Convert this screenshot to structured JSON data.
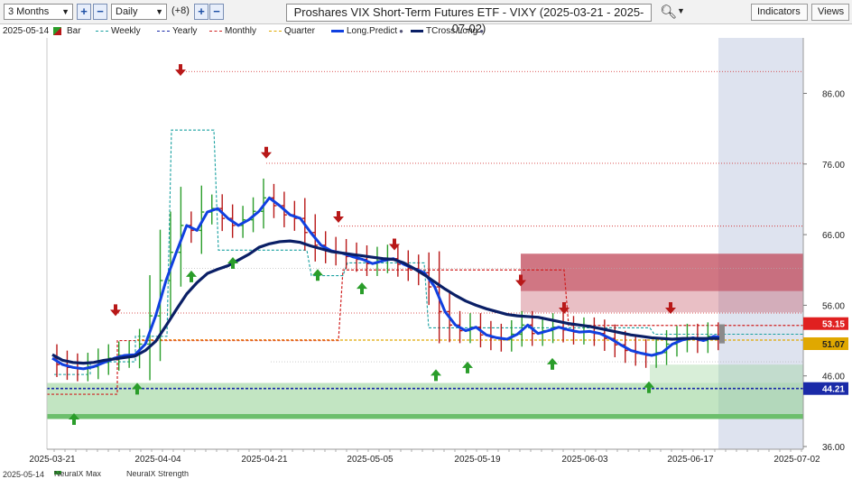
{
  "toolbar": {
    "range_value": "3 Months",
    "interval_value": "Daily",
    "offset_label": "(+8)",
    "title": "Proshares VIX Short-Term Futures ETF - VIXY (2025-03-21 - 2025-07-02)",
    "indicators_label": "Indicators",
    "views_label": "Views",
    "plus_label": "+",
    "minus_label": "−",
    "zoom_icon": "magnifier-icon"
  },
  "legend": {
    "cursor_date": "2025-05-14",
    "items": [
      {
        "label": "Bar",
        "color": "#2a9d2a"
      },
      {
        "label": "Weekly",
        "color": "#18a0a0"
      },
      {
        "label": "Yearly",
        "color": "#1a2aa8"
      },
      {
        "label": "Monthly",
        "color": "#d02020"
      },
      {
        "label": "Quarter",
        "color": "#e0a800"
      },
      {
        "label": "Long.Predict",
        "color": "#1040e0"
      },
      {
        "label": "TCross.Long",
        "color": "#0a1f66"
      }
    ]
  },
  "bottom": {
    "date": "2025-05-14",
    "tab1": "NeuralX Max",
    "tab2": "NeuralX Strength"
  },
  "colors": {
    "price_up": "#2a9d2a",
    "price_down": "#b81818",
    "long_predict": "#1040e0",
    "tcross_long": "#0a1f66",
    "monthly": "#d02020",
    "weekly": "#18a0a0",
    "yearly": "#1a2aa8",
    "quarter": "#e0a800",
    "sell_zone": "#c0485a",
    "buy_zone": "#8fcf8f",
    "future_shade": "#d8deec",
    "tag_red": "#e02020",
    "tag_gold": "#e0a800",
    "tag_blue": "#1a2aa8"
  },
  "chart_data": {
    "type": "line",
    "title": "Proshares VIX Short-Term Futures ETF - VIXY (2025-03-21 - 2025-07-02)",
    "x_ticks": [
      "2025-03-21",
      "2025-04-04",
      "2025-04-21",
      "2025-05-05",
      "2025-05-19",
      "2025-06-03",
      "2025-06-17",
      "2025-07-02"
    ],
    "y_ticks": [
      36.0,
      46.0,
      56.0,
      66.0,
      76.0,
      86.0
    ],
    "ylim": [
      36,
      90
    ],
    "grid": false,
    "series": [
      {
        "name": "Long.Predict",
        "values": [
          48.5,
          47.6,
          47.2,
          47.0,
          47.3,
          47.9,
          48.5,
          48.9,
          49.0,
          50.5,
          54.5,
          59.5,
          63.5,
          67.3,
          66.6,
          69.2,
          69.7,
          68.3,
          67.3,
          68.1,
          69.3,
          71.2,
          70.1,
          68.8,
          68.3,
          66.3,
          64.5,
          63.7,
          63.4,
          62.9,
          62.5,
          61.9,
          62.3,
          62.6,
          61.8,
          61.2,
          60.6,
          58.6,
          55.1,
          53.2,
          52.4,
          52.9,
          51.8,
          51.4,
          51.2,
          51.9,
          53.2,
          52.0,
          52.4,
          52.9,
          52.5,
          52.2,
          52.3,
          52.0,
          51.3,
          50.4,
          49.6,
          49.2,
          48.9,
          49.3,
          50.5,
          51.1,
          51.4,
          51.0,
          51.6,
          51.4
        ]
      },
      {
        "name": "TCross.Long",
        "values": [
          49.0,
          48.2,
          47.9,
          47.8,
          47.9,
          48.2,
          48.4,
          48.6,
          48.8,
          49.6,
          50.9,
          53.1,
          55.4,
          57.6,
          59.2,
          60.5,
          61.1,
          61.6,
          62.4,
          63.2,
          64.2,
          64.7,
          65.0,
          65.1,
          64.9,
          64.4,
          64.0,
          63.6,
          63.4,
          63.2,
          63.0,
          62.8,
          62.6,
          62.5,
          62.0,
          61.2,
          60.3,
          59.3,
          58.3,
          57.4,
          56.6,
          56.0,
          55.5,
          55.1,
          54.7,
          54.5,
          54.4,
          54.3,
          54.0,
          53.7,
          53.4,
          53.2,
          53.0,
          52.7,
          52.4,
          52.1,
          51.8,
          51.6,
          51.4,
          51.3,
          51.2,
          51.3,
          51.3,
          51.3,
          51.3,
          51.3
        ]
      }
    ],
    "horizontal_levels": [
      {
        "name": "Monthly",
        "value": 53.15
      },
      {
        "name": "Quarter",
        "value": 51.07
      },
      {
        "name": "Yearly",
        "value": 44.21
      }
    ],
    "price_tags": [
      "53.15",
      "51.07",
      "44.21"
    ]
  }
}
